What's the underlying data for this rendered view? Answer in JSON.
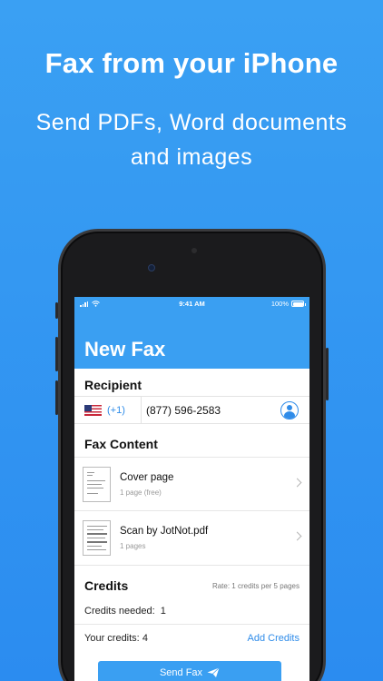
{
  "hero": {
    "title": "Fax from your iPhone",
    "subtitle_line1": "Send PDFs, Word documents",
    "subtitle_line2": "and images"
  },
  "status_bar": {
    "time": "9:41 AM",
    "battery": "100%",
    "battery_level": 1.0
  },
  "nav": {
    "title": "New Fax"
  },
  "recipient": {
    "section_title": "Recipient",
    "country_flag": "us-flag-icon",
    "dial_code": "(+1)",
    "phone_number": "(877) 596-2583"
  },
  "fax_content": {
    "section_title": "Fax Content",
    "items": [
      {
        "name": "Cover page",
        "meta": "1 page (free)"
      },
      {
        "name": "Scan by JotNot.pdf",
        "meta": "1 pages"
      }
    ]
  },
  "credits": {
    "title": "Credits",
    "rate": "Rate: 1 credits per 5 pages",
    "needed_label": "Credits needed:",
    "needed_value": "1",
    "yours_label": "Your credits:",
    "yours_value": "4",
    "add_label": "Add Credits"
  },
  "send": {
    "label": "Send Fax"
  },
  "colors": {
    "accent": "#3a9ff2",
    "link": "#2f8ce9"
  }
}
